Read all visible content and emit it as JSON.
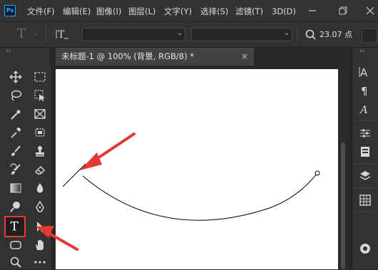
{
  "app": {
    "logo": "Ps"
  },
  "menu": [
    "文件(F)",
    "编辑(E)",
    "图像(I)",
    "图层(L)",
    "文字(Y)",
    "选择(S)",
    "滤镜(T)",
    "3D(D)"
  ],
  "options": {
    "font_size": "23.07 点"
  },
  "document": {
    "tab_title": "未标题-1 @ 100% (背景, RGB/8) *",
    "close_glyph": "×"
  },
  "colors": {
    "accent_red": "#e53935",
    "canvas": "#ffffff",
    "ui_bg": "#323232"
  },
  "icons": {
    "toolbox": [
      "move-icon",
      "marquee-icon",
      "lasso-icon",
      "object-select-icon",
      "quick-select-icon",
      "frame-icon",
      "eyedropper-icon",
      "patch-icon",
      "brush-icon",
      "stamp-icon",
      "history-brush-icon",
      "eraser-icon",
      "gradient-icon",
      "drop-icon",
      "dodge-icon",
      "pen-icon",
      "type-icon",
      "path-select-icon",
      "shape-icon",
      "hand-icon",
      "zoom-icon",
      "more-icon"
    ],
    "right_panel": [
      "character-icon",
      "paragraph-icon",
      "glyphs-icon",
      "adjust-icon",
      "properties-icon",
      "layers-icon",
      "channels-icon",
      "paths-icon"
    ]
  }
}
